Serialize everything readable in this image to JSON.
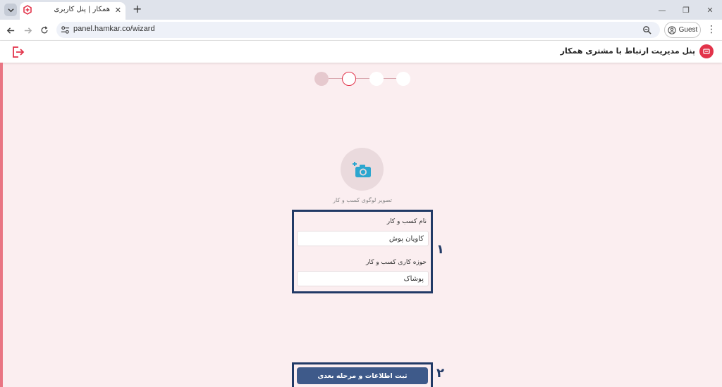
{
  "browser": {
    "tab_title": "همکار | پنل کاربری",
    "tab_close": "✕",
    "new_tab": "+",
    "url": "panel.hamkar.co/wizard",
    "profile_label": "Guest",
    "window_controls": [
      "—",
      "❐",
      "✕"
    ]
  },
  "header": {
    "title": "پنل مدیریت ارتباط با مشتری همکار",
    "brand_color": "#e2334a"
  },
  "wizard": {
    "steps": [
      {
        "state": "done"
      },
      {
        "state": "current"
      },
      {
        "state": "upcoming"
      },
      {
        "state": "upcoming"
      }
    ],
    "logo_caption": "تصویر لوگوی کسب و کار",
    "fields": [
      {
        "label": "نام کسب و کار",
        "value": "کاویان پوش"
      },
      {
        "label": "حوزه کاری کسب و کار",
        "value": "پوشاک"
      }
    ],
    "submit_label": "ثبت اطلاعات و مرحله بعدی"
  },
  "annotations": {
    "marker_1": "۱",
    "marker_2": "۲",
    "box_color": "#213a66"
  },
  "colors": {
    "page_background": "#fbeef0",
    "accent": "#e2334a",
    "button": "#3e5a8a"
  }
}
